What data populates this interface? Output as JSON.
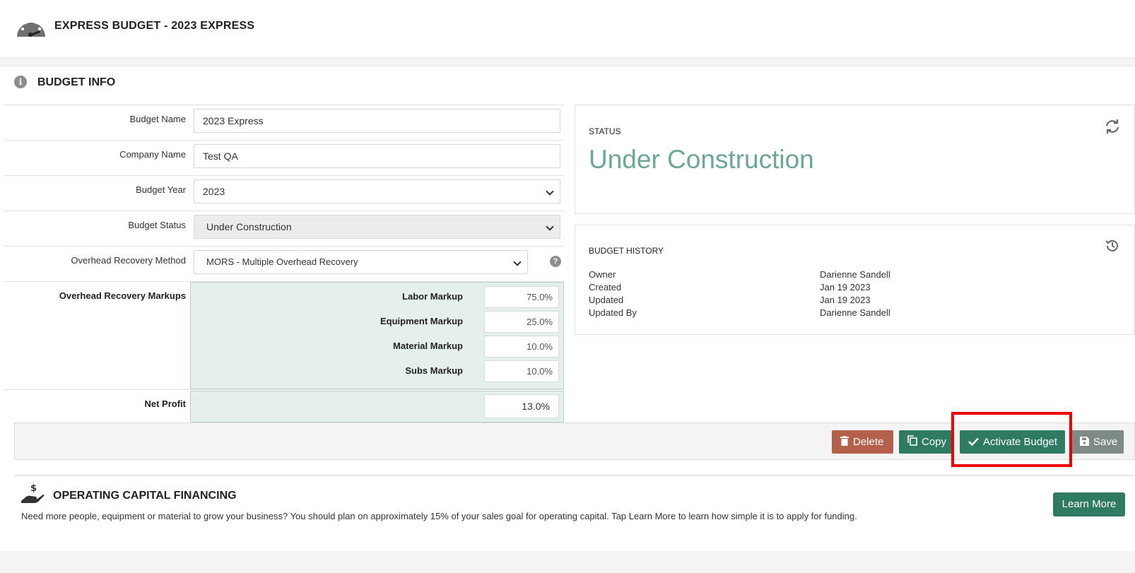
{
  "header": {
    "title": "EXPRESS BUDGET - 2023 EXPRESS",
    "logo_icon": "speedometer-icon"
  },
  "budget_info": {
    "section_title": "BUDGET INFO",
    "fields": {
      "budget_name": {
        "label": "Budget Name",
        "value": "2023 Express"
      },
      "company_name": {
        "label": "Company Name",
        "value": "Test QA"
      },
      "budget_year": {
        "label": "Budget Year",
        "value": "2023"
      },
      "budget_status": {
        "label": "Budget Status",
        "value": "Under Construction"
      },
      "overhead_method": {
        "label": "Overhead Recovery Method",
        "value": "MORS - Multiple Overhead Recovery"
      }
    },
    "markups": {
      "label": "Overhead Recovery Markups",
      "items": [
        {
          "label": "Labor Markup",
          "value": "75.0%"
        },
        {
          "label": "Equipment Markup",
          "value": "25.0%"
        },
        {
          "label": "Material Markup",
          "value": "10.0%"
        },
        {
          "label": "Subs Markup",
          "value": "10.0%"
        }
      ]
    },
    "net_profit": {
      "label": "Net Profit",
      "value": "13.0%"
    }
  },
  "status_card": {
    "label": "STATUS",
    "value": "Under Construction"
  },
  "history_card": {
    "label": "BUDGET HISTORY",
    "rows": [
      {
        "key": "Owner",
        "value": "Darienne Sandell"
      },
      {
        "key": "Created",
        "value": "Jan 19 2023"
      },
      {
        "key": "Updated",
        "value": "Jan 19 2023"
      },
      {
        "key": "Updated By",
        "value": "Darienne Sandell"
      }
    ]
  },
  "actions": {
    "delete": "Delete",
    "copy": "Copy",
    "activate": "Activate Budget",
    "save": "Save"
  },
  "financing": {
    "title": "OPERATING CAPITAL FINANCING",
    "text": "Need more people, equipment or material to grow your business? You should plan on approximately 15% of your sales goal for operating capital. Tap Learn More to learn how simple it is to apply for funding.",
    "learn_more": "Learn More"
  },
  "colors": {
    "primary_green": "#2f7a63",
    "delete_red": "#b4604a",
    "save_gray": "#7f8a86",
    "status_text": "#6aa894",
    "highlight": "#ee0000"
  }
}
